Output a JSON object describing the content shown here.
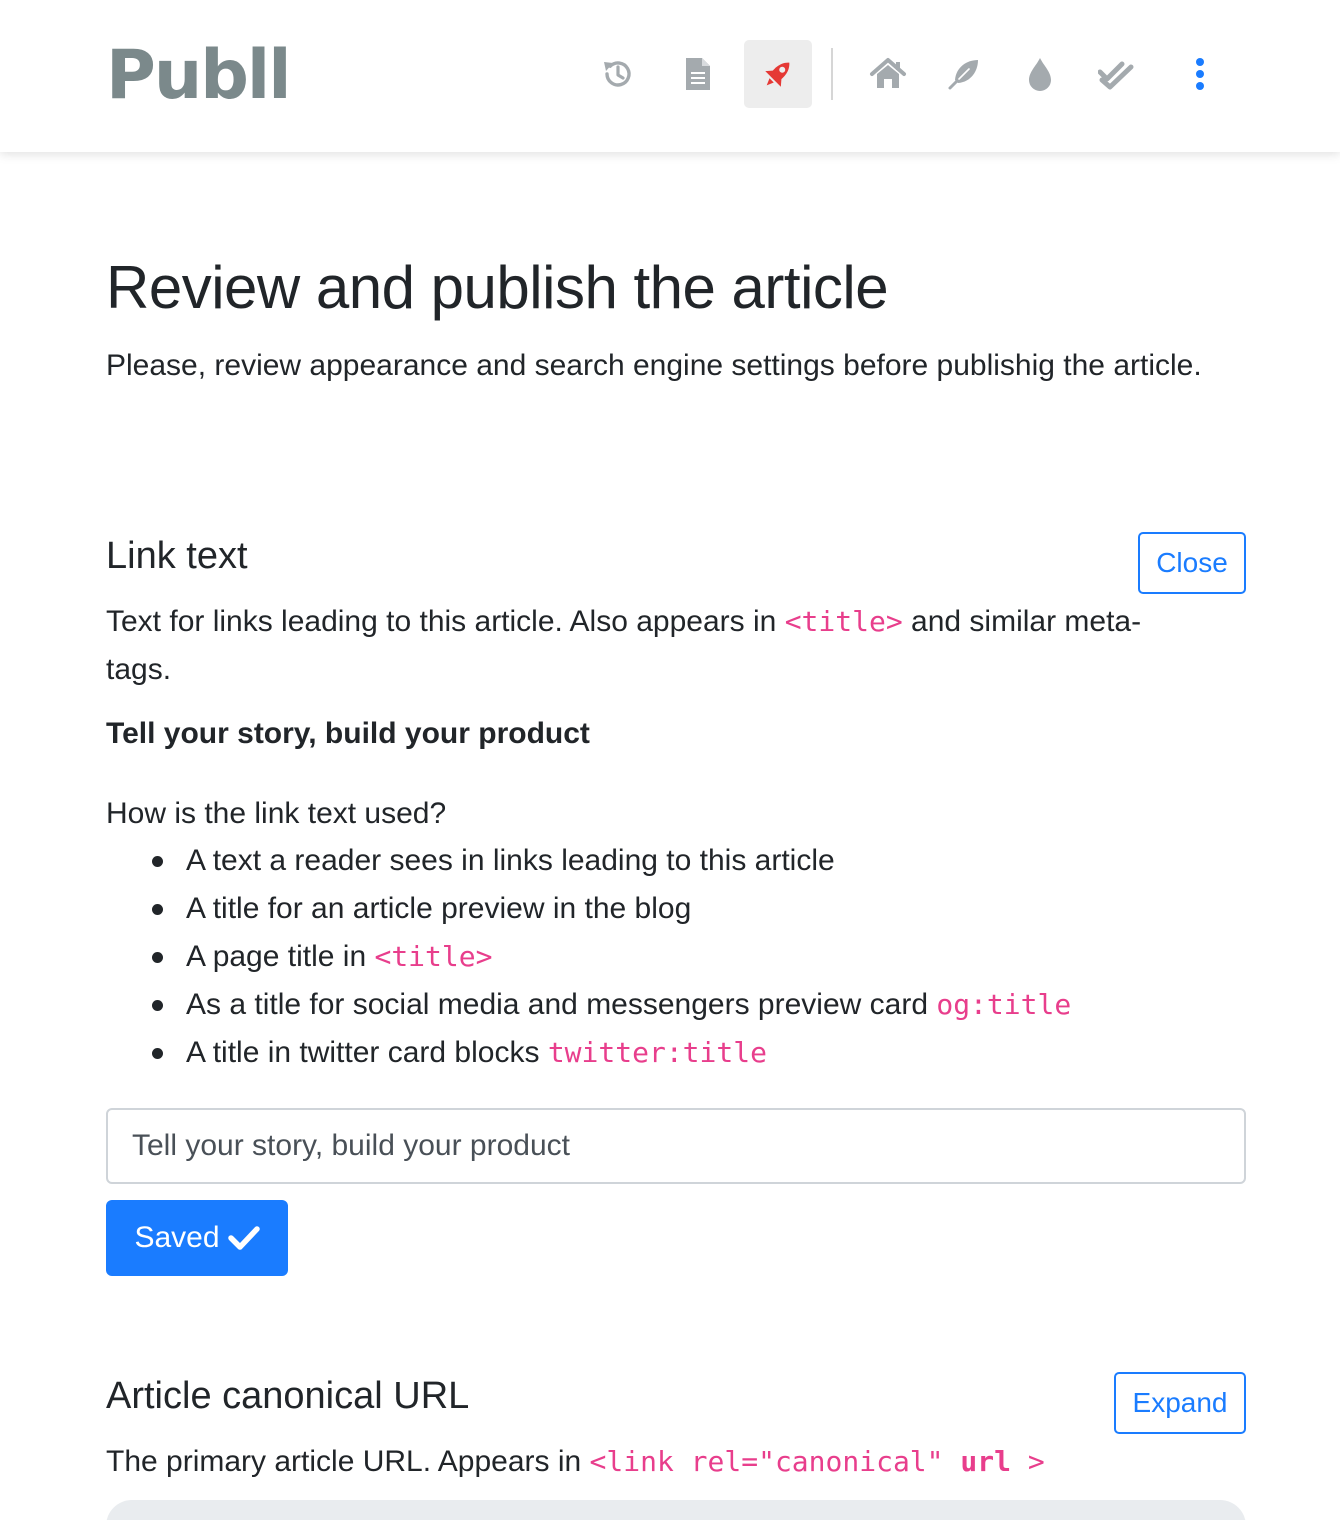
{
  "header": {
    "brand": "Publl",
    "icons": [
      "history-icon",
      "document-icon",
      "rocket-icon",
      "home-icon",
      "feather-icon",
      "drop-icon",
      "double-check-icon",
      "kebab-menu-icon"
    ],
    "active": "rocket-icon",
    "colors": {
      "icon": "#a4aaae",
      "active": "#e53935",
      "menu": "#1a7cff",
      "brand": "#7b898b"
    }
  },
  "page": {
    "title": "Review and publish the article",
    "lead": "Please, review appearance and search engine settings before publishig the article."
  },
  "link_text": {
    "heading": "Link text",
    "toggle_label": "Close",
    "desc_before": "Text for links leading to this article. Also appears in ",
    "desc_code": "<title>",
    "desc_after": " and similar meta-tags.",
    "current_value": "Tell your story, build your product",
    "usage_question": "How is the link text used?",
    "usage": [
      {
        "text": "A text a reader sees in links leading to this article",
        "code": ""
      },
      {
        "text": "A title for an article preview in the blog",
        "code": ""
      },
      {
        "text": "A page title in ",
        "code": "<title>"
      },
      {
        "text": "As a title for social media and messengers preview card ",
        "code": "og:title"
      },
      {
        "text": "A title in twitter card blocks ",
        "code": "twitter:title"
      }
    ],
    "input_value": "Tell your story, build your product",
    "save_label": "Saved"
  },
  "canonical_url": {
    "heading": "Article canonical URL",
    "toggle_label": "Expand",
    "desc_before": "The primary article URL. Appears in ",
    "desc_code_1": "<link rel=\"canonical\" ",
    "desc_code_2": "url",
    "desc_code_3": " >"
  },
  "accent_color": "#1a7cff",
  "code_color": "#e83e8c"
}
